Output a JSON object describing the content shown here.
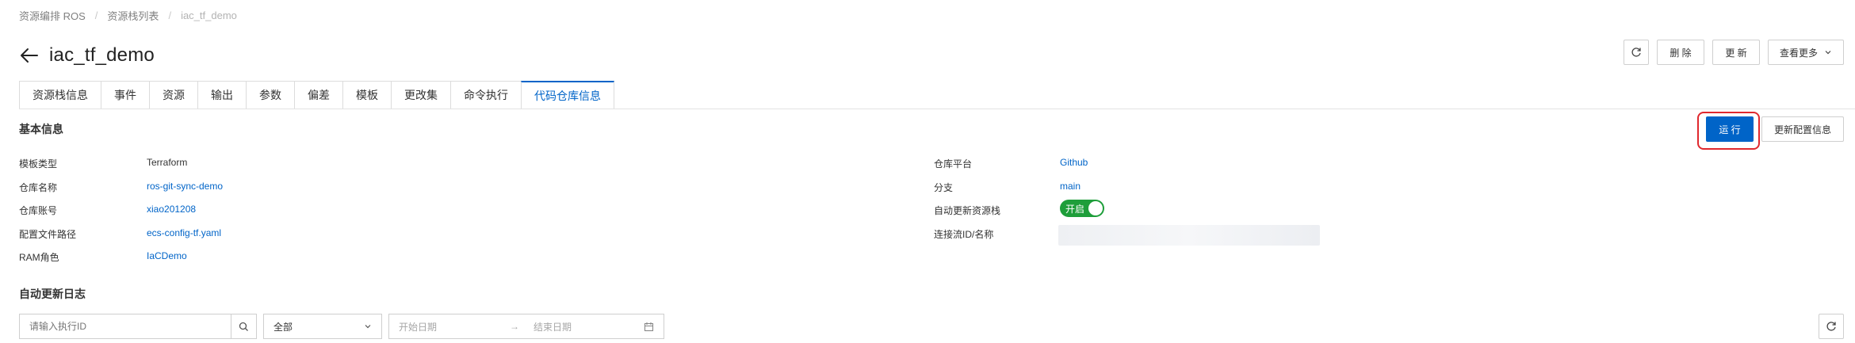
{
  "breadcrumb": {
    "items": [
      "资源编排 ROS",
      "资源栈列表"
    ],
    "current": "iac_tf_demo",
    "separator": "/"
  },
  "header": {
    "title": "iac_tf_demo",
    "actions": {
      "delete_label": "删 除",
      "update_label": "更 新",
      "more_label": "查看更多"
    }
  },
  "tabs": [
    {
      "label": "资源栈信息",
      "active": false
    },
    {
      "label": "事件",
      "active": false
    },
    {
      "label": "资源",
      "active": false
    },
    {
      "label": "输出",
      "active": false
    },
    {
      "label": "参数",
      "active": false
    },
    {
      "label": "偏差",
      "active": false
    },
    {
      "label": "模板",
      "active": false
    },
    {
      "label": "更改集",
      "active": false
    },
    {
      "label": "命令执行",
      "active": false
    },
    {
      "label": "代码仓库信息",
      "active": true
    }
  ],
  "basic_info": {
    "title": "基本信息",
    "run_label": "运 行",
    "update_config_label": "更新配置信息",
    "left": [
      {
        "label": "模板类型",
        "value": "Terraform",
        "link": false
      },
      {
        "label": "仓库名称",
        "value": "ros-git-sync-demo",
        "link": true
      },
      {
        "label": "仓库账号",
        "value": "xiao201208",
        "link": true
      },
      {
        "label": "配置文件路径",
        "value": "ecs-config-tf.yaml",
        "link": true
      },
      {
        "label": "RAM角色",
        "value": "IaCDemo",
        "link": true
      }
    ],
    "right": {
      "platform_label": "仓库平台",
      "platform_value": "Github",
      "branch_label": "分支",
      "branch_value": "main",
      "auto_update_label": "自动更新资源栈",
      "auto_update_toggle": "开启",
      "connection_label": "连接流ID/名称"
    }
  },
  "log": {
    "title": "自动更新日志",
    "search_placeholder": "请输入执行ID",
    "status_select": "全部",
    "start_placeholder": "开始日期",
    "end_placeholder": "结束日期",
    "range_arrow": "→"
  },
  "colors": {
    "primary": "#0064c8",
    "toggle_on": "#1e9e3a",
    "highlight": "#e0282e"
  }
}
